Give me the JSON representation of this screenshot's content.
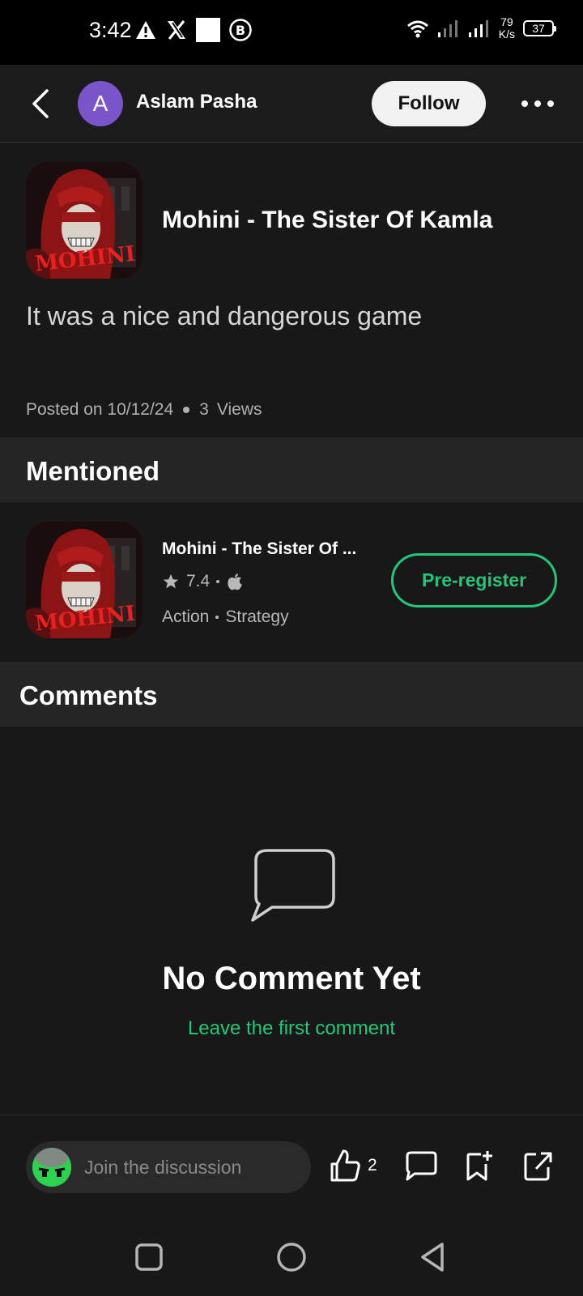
{
  "status_bar": {
    "time": "3:42",
    "net_speed_value": "79",
    "net_speed_unit": "K/s",
    "battery": "37"
  },
  "header": {
    "avatar_letter": "A",
    "author": "Aslam Pasha",
    "follow_label": "Follow"
  },
  "post": {
    "game_title": "Mohini - The Sister Of Kamla",
    "icon_text": "MOHINI",
    "body": "It was a nice and dangerous game",
    "posted_on": "Posted on 10/12/24",
    "views_count": "3",
    "views_label": "Views"
  },
  "mentioned": {
    "section_title": "Mentioned",
    "game_name": "Mohini - The Sister Of ...",
    "rating": "7.4",
    "tags": [
      "Action",
      "Strategy"
    ],
    "button_label": "Pre-register"
  },
  "comments": {
    "section_title": "Comments",
    "empty_title": "No Comment Yet",
    "empty_link": "Leave the first comment"
  },
  "bottom_bar": {
    "input_placeholder": "Join the discussion",
    "like_count": "2"
  },
  "colors": {
    "accent": "#22c77a",
    "background": "#181818",
    "section_bg": "#252525",
    "avatar": "#7a55c9"
  }
}
